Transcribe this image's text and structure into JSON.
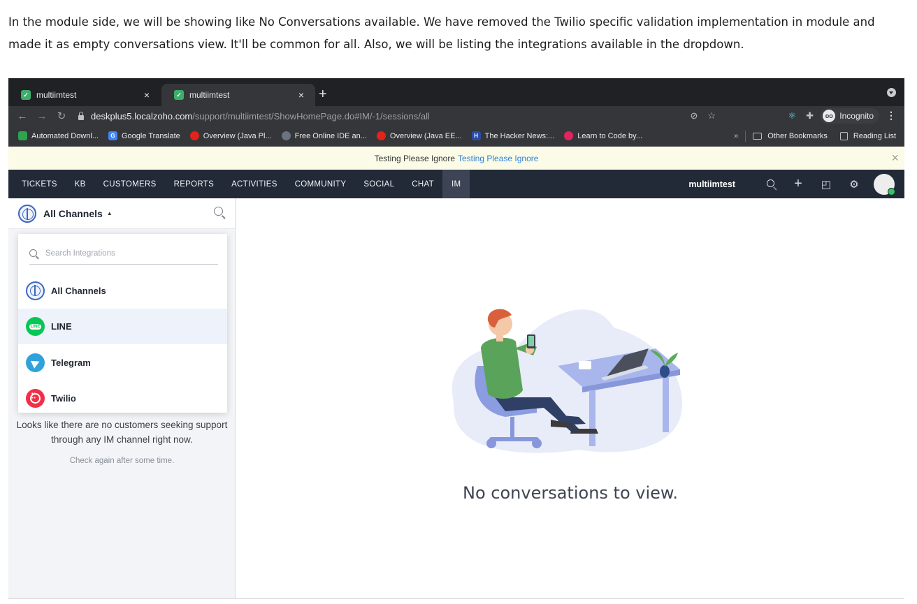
{
  "intro_text": "In the module side, we will be showing like No Conversations available. We have removed the Twilio specific validation implementation in module and made it as empty conversations view. It'll be common for all. Also, we will be listing the integrations available in the dropdown.",
  "browser": {
    "tabs": [
      {
        "label": "multiimtest",
        "close": "×"
      },
      {
        "label": "multiimtest",
        "close": "×"
      }
    ],
    "new_tab": "+",
    "url_host": "deskplus5.localzoho.com",
    "url_path": "/support/multiimtest/ShowHomePage.do#IM/-1/sessions/all",
    "incognito_label": "Incognito",
    "bookmarks": [
      {
        "label": "Automated Downl...",
        "icon": "green-leaf-icon",
        "color": "#2ea44f"
      },
      {
        "label": "Google Translate",
        "icon": "google-translate-icon",
        "color": "#4285f4"
      },
      {
        "label": "Overview (Java Pl...",
        "icon": "oracle-icon",
        "color": "#e2231a"
      },
      {
        "label": "Free Online IDE an...",
        "icon": "ide-icon",
        "color": "#6b7280"
      },
      {
        "label": "Overview (Java EE...",
        "icon": "oracle-icon",
        "color": "#e2231a"
      },
      {
        "label": "The Hacker News:...",
        "icon": "hacker-news-icon",
        "color": "#2b4ba8"
      },
      {
        "label": "Learn to Code by...",
        "icon": "codecademy-icon",
        "color": "#e0245e"
      }
    ],
    "bookmarks_more": "»",
    "other_bookmarks": "Other Bookmarks",
    "reading_list": "Reading List"
  },
  "banner": {
    "text": "Testing Please Ignore",
    "link": "Testing Please Ignore",
    "close": "×"
  },
  "topnav": {
    "items": [
      "TICKETS",
      "KB",
      "CUSTOMERS",
      "REPORTS",
      "ACTIVITIES",
      "COMMUNITY",
      "SOCIAL",
      "CHAT",
      "IM"
    ],
    "active": "IM",
    "portal_name": "multiimtest"
  },
  "left_panel": {
    "title": "All Channels",
    "empty_message": "Looks like there are no customers seeking support through any IM channel right now.",
    "empty_hint": "Check again after some time."
  },
  "dropdown": {
    "search_placeholder": "Search Integrations",
    "items": [
      {
        "label": "All Channels",
        "icon": "globe-icon"
      },
      {
        "label": "LINE",
        "icon": "line-icon",
        "color": "#06c755",
        "icon_text": "LINE"
      },
      {
        "label": "Telegram",
        "icon": "telegram-icon",
        "color": "#2fa2db"
      },
      {
        "label": "Twilio",
        "icon": "twilio-icon",
        "color": "#f22f46"
      }
    ],
    "selected_index": 1
  },
  "main": {
    "empty_title": "No conversations to view."
  }
}
